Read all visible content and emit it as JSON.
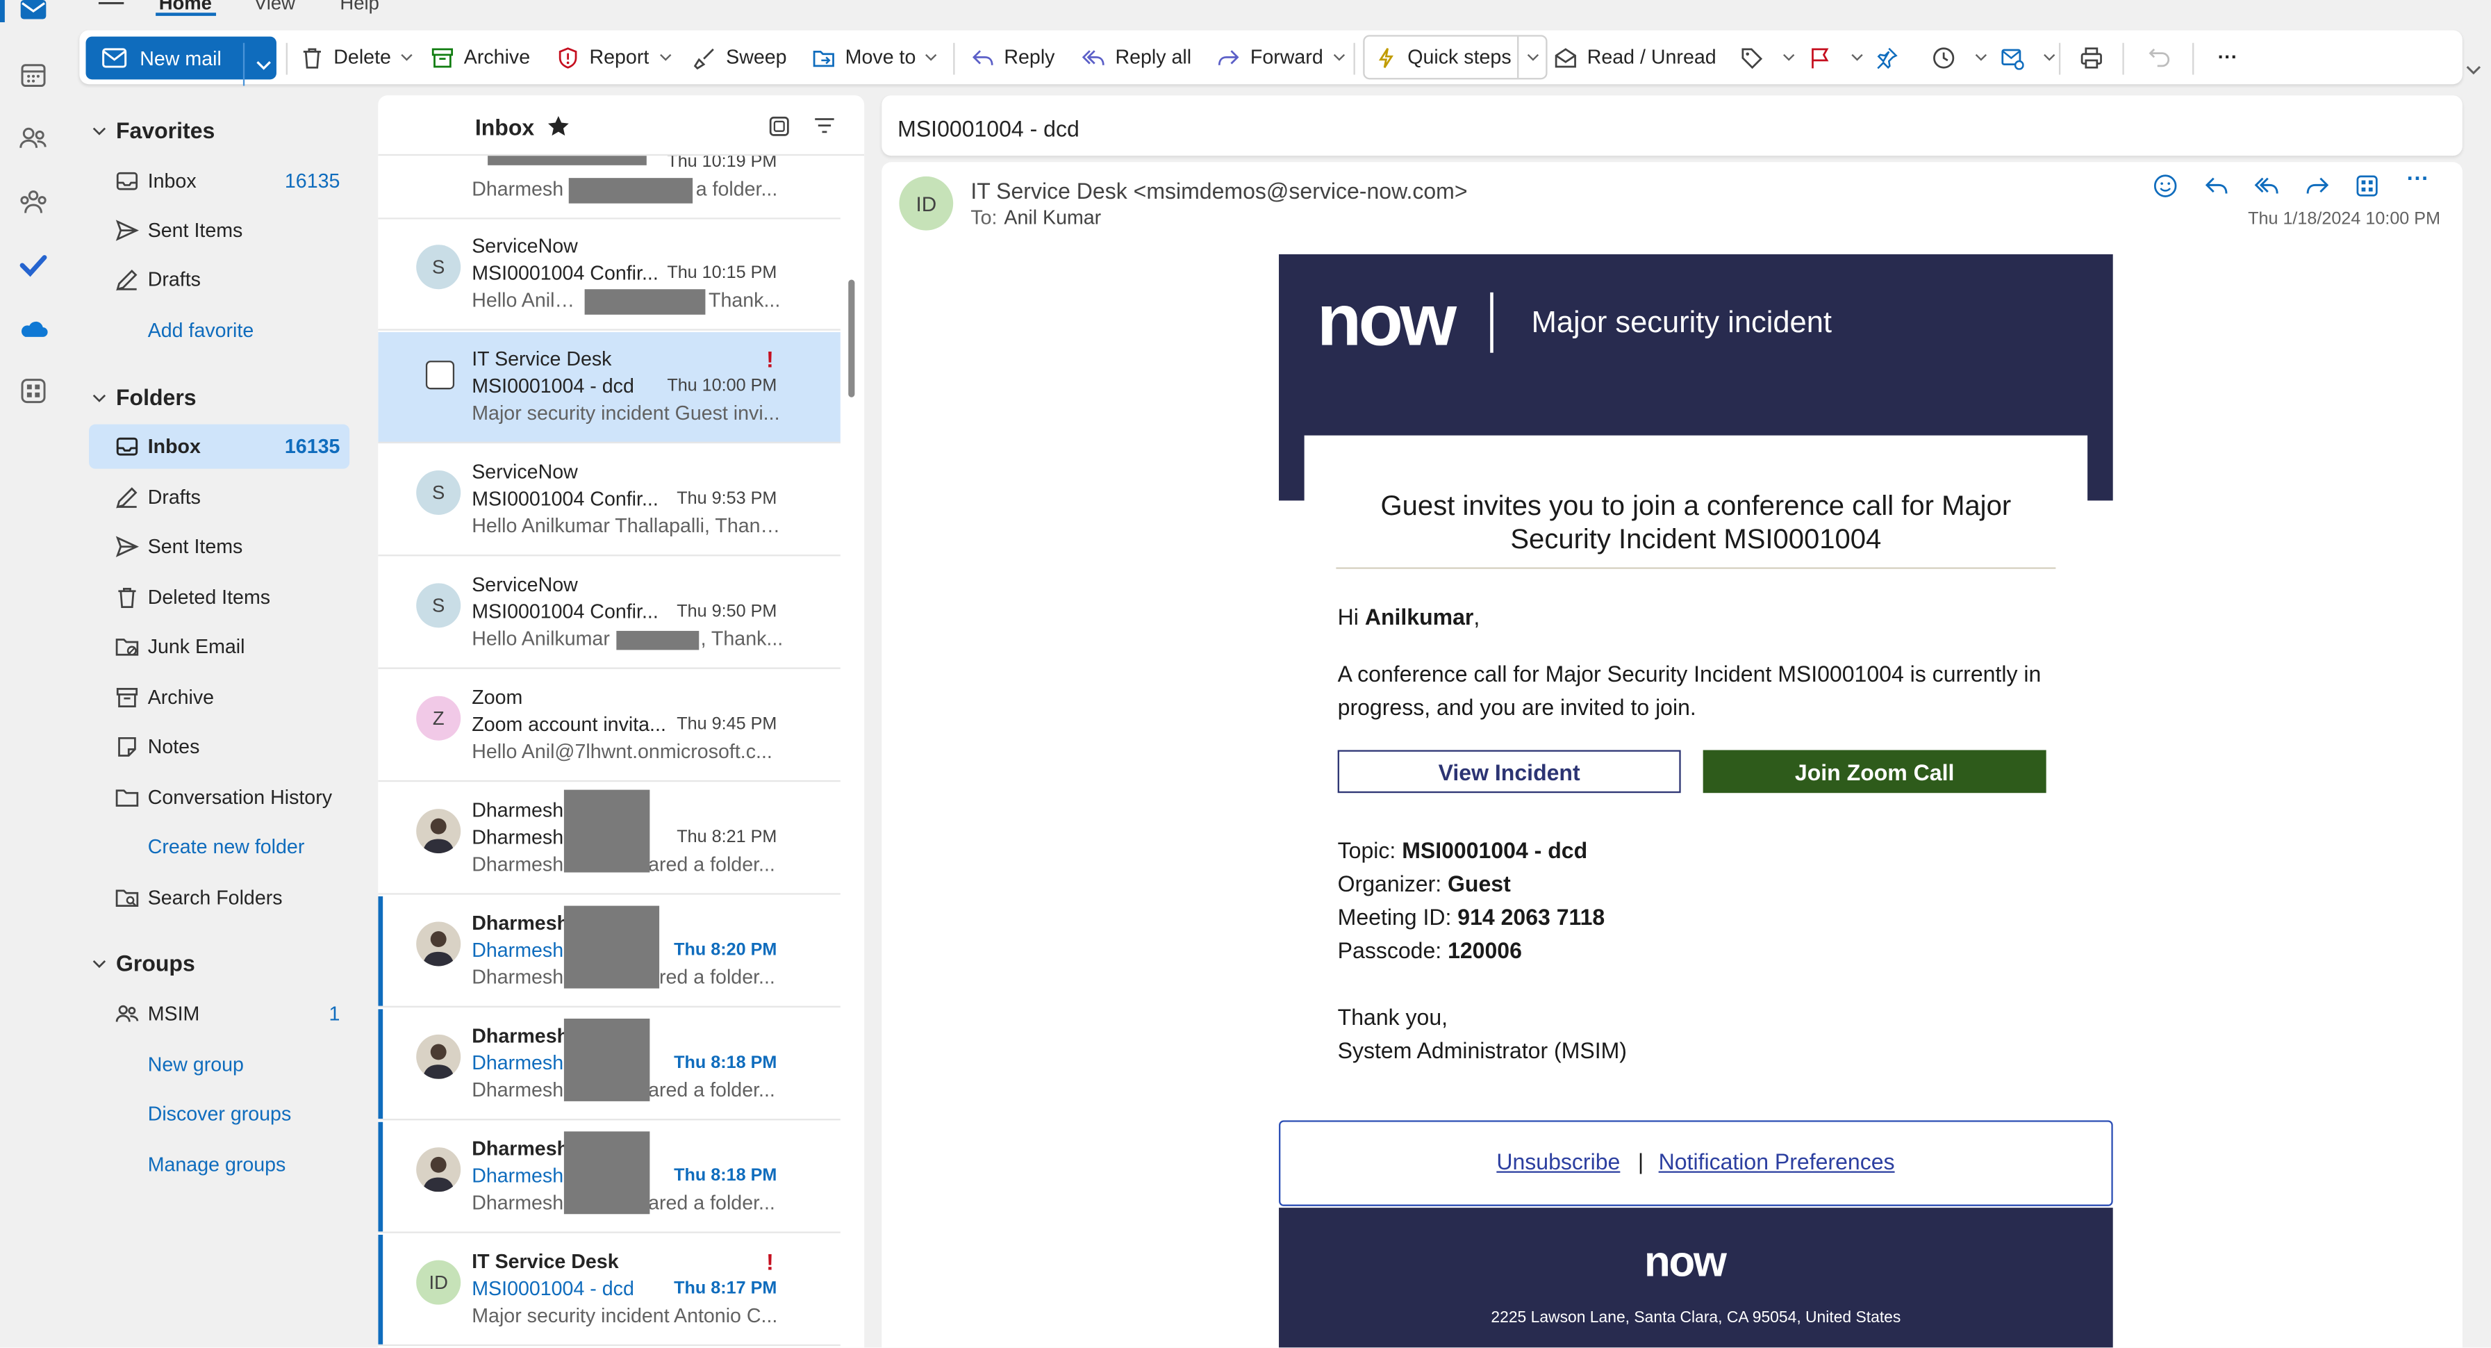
{
  "ribbon": {
    "tabs": [
      "Home",
      "View",
      "Help"
    ],
    "new_mail": "New mail",
    "delete": "Delete",
    "archive": "Archive",
    "report": "Report",
    "sweep": "Sweep",
    "move_to": "Move to",
    "reply": "Reply",
    "reply_all": "Reply all",
    "forward": "Forward",
    "quick_steps": "Quick steps",
    "read_unread": "Read / Unread",
    "more": "···"
  },
  "folders": {
    "favorites_header": "Favorites",
    "favorites": [
      {
        "label": "Inbox",
        "count": "16135"
      },
      {
        "label": "Sent Items",
        "count": ""
      },
      {
        "label": "Drafts",
        "count": ""
      }
    ],
    "add_favorite": "Add favorite",
    "folders_header": "Folders",
    "items": [
      {
        "label": "Inbox",
        "count": "16135"
      },
      {
        "label": "Drafts",
        "count": ""
      },
      {
        "label": "Sent Items",
        "count": ""
      },
      {
        "label": "Deleted Items",
        "count": ""
      },
      {
        "label": "Junk Email",
        "count": ""
      },
      {
        "label": "Archive",
        "count": ""
      },
      {
        "label": "Notes",
        "count": ""
      },
      {
        "label": "Conversation History",
        "count": ""
      }
    ],
    "create_new_folder": "Create new folder",
    "search_folders": "Search Folders",
    "groups_header": "Groups",
    "group_msim": "MSIM",
    "group_msim_count": "1",
    "new_group": "New group",
    "discover_groups": "Discover groups",
    "manage_groups": "Manage groups"
  },
  "list": {
    "title": "Inbox",
    "messages": [
      {
        "from": "",
        "subject": "",
        "time": "Thu 10:19 PM",
        "preview": "Dharmesh",
        "preview_tail": "a folder...",
        "avatar": ""
      },
      {
        "from": "ServiceNow",
        "subject": "MSI0001004 Confir...",
        "time": "Thu 10:15 PM",
        "preview": "Hello Anilkun",
        "preview_tail": "Thank...",
        "avatar": "S"
      },
      {
        "from": "IT Service Desk",
        "subject": "MSI0001004 - dcd",
        "time": "Thu 10:00 PM",
        "preview": "Major security incident Guest invi...",
        "avatar": ""
      },
      {
        "from": "ServiceNow",
        "subject": "MSI0001004 Confir...",
        "time": "Thu 9:53 PM",
        "preview": "Hello Anilkumar Thallapalli, Thank...",
        "avatar": "S"
      },
      {
        "from": "ServiceNow",
        "subject": "MSI0001004 Confir...",
        "time": "Thu 9:50 PM",
        "preview": "Hello Anilkumar",
        "preview_tail": ", Thank...",
        "avatar": "S"
      },
      {
        "from": "Zoom",
        "subject": "Zoom account invita...",
        "time": "Thu 9:45 PM",
        "preview": "Hello Anil@7lhwnt.onmicrosoft.c...",
        "avatar": "Z"
      },
      {
        "from": "Dharmesh",
        "subject": "Dharmesh",
        "time": "Thu 8:21 PM",
        "preview": "Dharmesh",
        "preview_tail": "ared a folder...",
        "avatar": ""
      },
      {
        "from": "Dharmesh",
        "subject": "Dharmesh",
        "time": "Thu 8:20 PM",
        "preview": "Dharmesh",
        "preview_tail": "ared a folder...",
        "avatar": ""
      },
      {
        "from": "Dharmesh",
        "subject": "Dharmesh",
        "time": "Thu 8:18 PM",
        "preview": "Dharmesh",
        "preview_tail": "ared a folder...",
        "avatar": ""
      },
      {
        "from": "Dharmesh",
        "subject": "Dharmesh",
        "time": "Thu 8:18 PM",
        "preview": "Dharmesh",
        "preview_tail": "ared a folder...",
        "avatar": ""
      },
      {
        "from": "IT Service Desk",
        "subject": "MSI0001004 - dcd",
        "time": "Thu 8:17 PM",
        "preview": "Major security incident Antonio C...",
        "avatar": "ID"
      }
    ]
  },
  "reading": {
    "subject": "MSI0001004 - dcd",
    "avatar": "ID",
    "sender": "IT Service Desk <msimdemos@service-now.com>",
    "to_label": "To:",
    "to": "Anil Kumar",
    "datetime": "Thu 1/18/2024 10:00 PM"
  },
  "email": {
    "logo": "now",
    "banner_title": "Major security incident",
    "heading": "Guest invites you to join a conference call for Major Security Incident MSI0001004",
    "greeting_prefix": "Hi ",
    "greeting_name": "Anilkumar",
    "greeting_suffix": ",",
    "body": "A conference call for Major Security Incident MSI0001004 is currently in progress, and you are invited to join.",
    "view_incident": "View Incident",
    "join_zoom": "Join Zoom Call",
    "topic_label": "Topic: ",
    "topic": "MSI0001004 - dcd",
    "organizer_label": "Organizer: ",
    "organizer": "Guest",
    "meeting_id_label": "Meeting ID: ",
    "meeting_id": "914 2063 7118",
    "passcode_label": "Passcode: ",
    "passcode": "120006",
    "thanks": "Thank you,",
    "signature": "System Administrator (MSIM)",
    "unsubscribe": "Unsubscribe",
    "separator": "|",
    "notification_prefs": "Notification Preferences",
    "footer_logo": "now",
    "address": "2225 Lawson Lane, Santa Clara, CA 95054, United States"
  },
  "colors": {
    "accent": "#0f6cbd",
    "banner": "#2a2d4f",
    "join_button": "#2e5b1b",
    "importance": "#c50f1f"
  }
}
